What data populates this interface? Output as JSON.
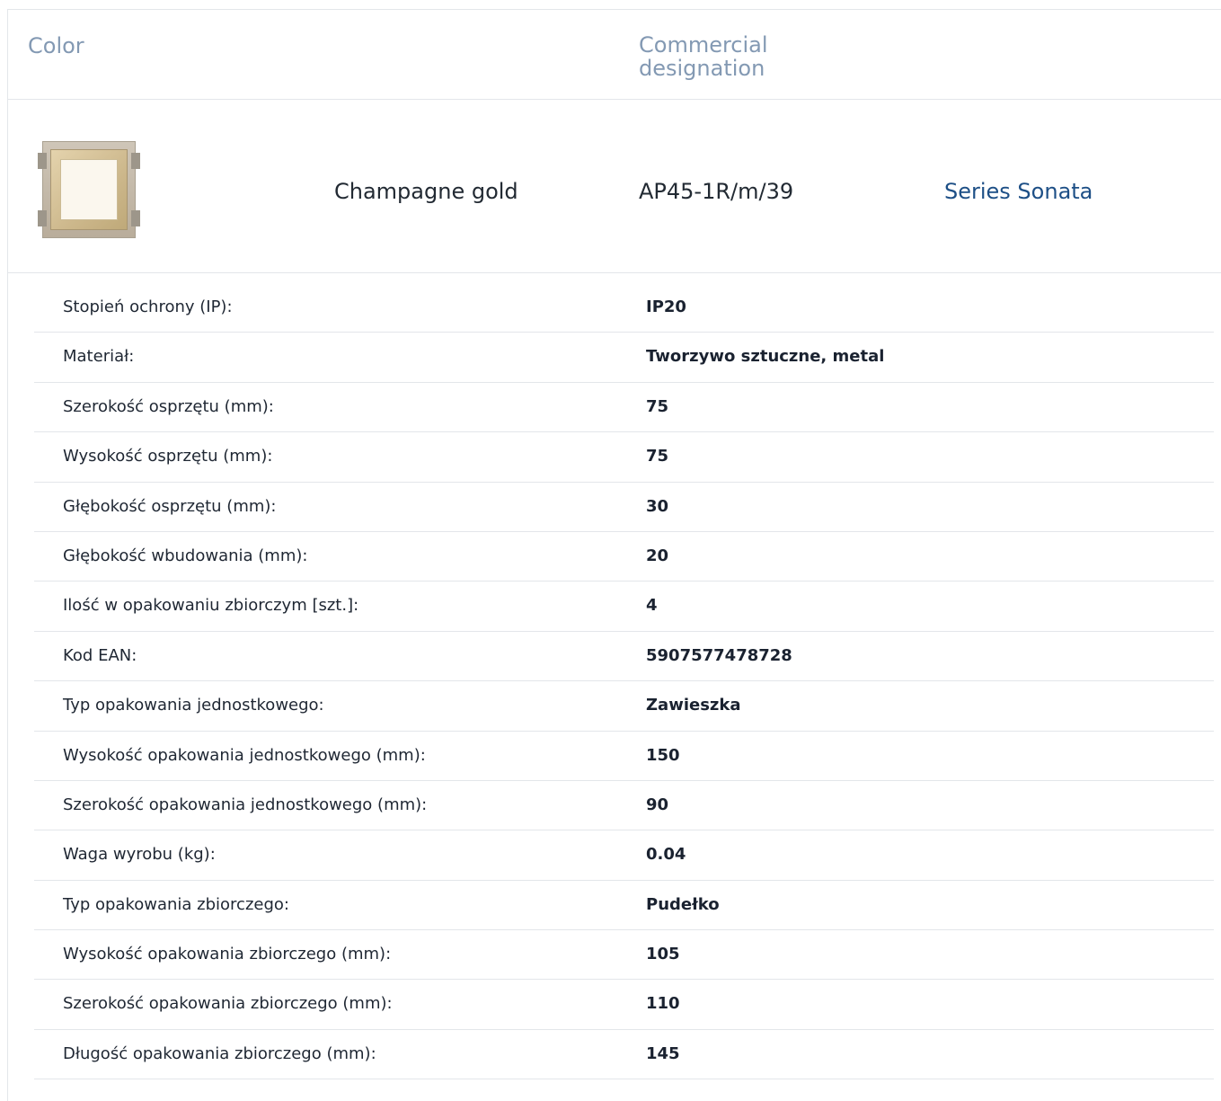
{
  "header": {
    "color_label": "Color",
    "designation_label": "Commercial designation"
  },
  "product": {
    "image_icon": "product-switch-frame-image",
    "color": "Champagne gold",
    "code": "AP45-1R/m/39",
    "series_link": "Series Sonata"
  },
  "specs": [
    {
      "label": "Stopień ochrony (IP):",
      "value": "IP20"
    },
    {
      "label": "Materiał:",
      "value": "Tworzywo sztuczne, metal"
    },
    {
      "label": "Szerokość osprzętu (mm):",
      "value": "75"
    },
    {
      "label": "Wysokość osprzętu (mm):",
      "value": "75"
    },
    {
      "label": "Głębokość osprzętu (mm):",
      "value": "30"
    },
    {
      "label": "Głębokość wbudowania (mm):",
      "value": "20"
    },
    {
      "label": "Ilość w opakowaniu zbiorczym [szt.]:",
      "value": "4"
    },
    {
      "label": "Kod EAN:",
      "value": "5907577478728"
    },
    {
      "label": "Typ opakowania jednostkowego:",
      "value": "Zawieszka"
    },
    {
      "label": "Wysokość opakowania jednostkowego (mm):",
      "value": "150"
    },
    {
      "label": "Szerokość opakowania jednostkowego (mm):",
      "value": "90"
    },
    {
      "label": "Waga wyrobu (kg):",
      "value": "0.04"
    },
    {
      "label": "Typ opakowania zbiorczego:",
      "value": "Pudełko"
    },
    {
      "label": "Wysokość opakowania zbiorczego (mm):",
      "value": "105"
    },
    {
      "label": "Szerokość opakowania zbiorczego (mm):",
      "value": "110"
    },
    {
      "label": "Długość opakowania zbiorczego (mm):",
      "value": "145"
    }
  ],
  "colors": {
    "header_text": "#8399b3",
    "link": "#1d4f86",
    "border": "#e3e6ea"
  }
}
